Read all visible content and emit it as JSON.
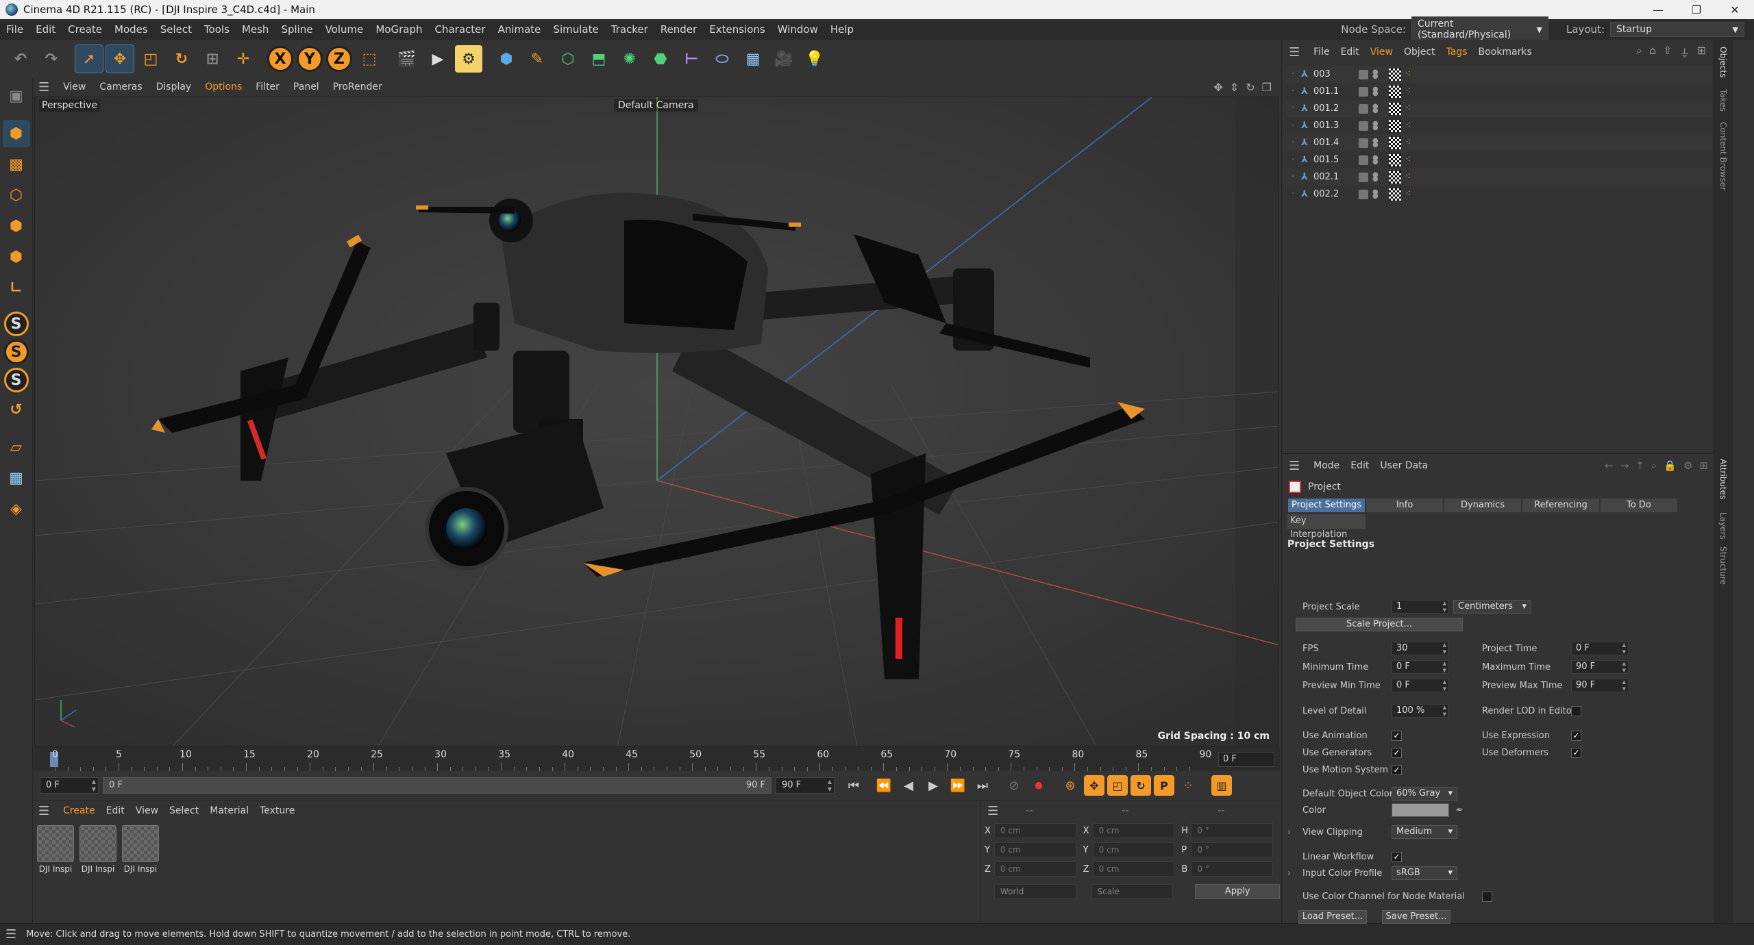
{
  "window": {
    "title": "Cinema 4D R21.115 (RC) - [DJI Inspire 3_C4D.c4d] - Main"
  },
  "menubar": {
    "items": [
      "File",
      "Edit",
      "Create",
      "Modes",
      "Select",
      "Tools",
      "Mesh",
      "Spline",
      "Volume",
      "MoGraph",
      "Character",
      "Animate",
      "Simulate",
      "Tracker",
      "Render",
      "Extensions",
      "Window",
      "Help"
    ],
    "node_space_label": "Node Space:",
    "node_space_value": "Current (Standard/Physical)",
    "layout_label": "Layout:",
    "layout_value": "Startup"
  },
  "viewport": {
    "menu": [
      "View",
      "Cameras",
      "Display",
      "Options",
      "Filter",
      "Panel",
      "ProRender"
    ],
    "label": "Perspective",
    "camera": "Default Camera",
    "grid_spacing": "Grid Spacing : 10 cm"
  },
  "timeline": {
    "ticks": [
      "0",
      "5",
      "10",
      "15",
      "20",
      "25",
      "30",
      "35",
      "40",
      "45",
      "50",
      "55",
      "60",
      "65",
      "70",
      "75",
      "80",
      "85",
      "90"
    ],
    "current_frame": "0 F",
    "start": "0 F",
    "range_start": "0 F",
    "range_end": "90 F",
    "end": "90 F"
  },
  "materials": {
    "menu": [
      "Create",
      "Edit",
      "View",
      "Select",
      "Material",
      "Texture"
    ],
    "items": [
      "DJI Inspi",
      "DJI Inspi",
      "DJI Inspi"
    ]
  },
  "coords": {
    "head_dash": "--",
    "rows": [
      {
        "a1": "X",
        "v1": "0 cm",
        "a2": "X",
        "v2": "0 cm",
        "a3": "H",
        "v3": "0 °"
      },
      {
        "a1": "Y",
        "v1": "0 cm",
        "a2": "Y",
        "v2": "0 cm",
        "a3": "P",
        "v3": "0 °"
      },
      {
        "a1": "Z",
        "v1": "0 cm",
        "a2": "Z",
        "v2": "0 cm",
        "a3": "B",
        "v3": "0 °"
      }
    ],
    "space": "World",
    "mode": "Scale",
    "apply": "Apply"
  },
  "status": "Move: Click and drag to move elements. Hold down SHIFT to quantize movement / add to the selection in point mode, CTRL to remove.",
  "objects": {
    "menu": [
      "File",
      "Edit",
      "View",
      "Object",
      "Tags",
      "Bookmarks"
    ],
    "items": [
      "003",
      "001.1",
      "001.2",
      "001.3",
      "001.4",
      "001.5",
      "002.1",
      "002.2"
    ]
  },
  "side_tabs": {
    "top": [
      "Objects",
      "Takes",
      "Content Browser"
    ],
    "bottom": [
      "Attributes",
      "Layers",
      "Structure"
    ]
  },
  "attributes": {
    "menu": [
      "Mode",
      "Edit",
      "User Data"
    ],
    "object": "Project",
    "tabs": [
      "Project Settings",
      "Info",
      "Dynamics",
      "Referencing",
      "To Do"
    ],
    "tab2": "Key Interpolation",
    "section": "Project Settings",
    "project_scale_label": "Project Scale",
    "project_scale": "1",
    "project_scale_unit": "Centimeters",
    "scale_project_btn": "Scale Project...",
    "fps_label": "FPS",
    "fps": "30",
    "project_time_label": "Project Time",
    "project_time": "0 F",
    "min_time_label": "Minimum Time",
    "min_time": "0 F",
    "max_time_label": "Maximum Time",
    "max_time": "90 F",
    "prev_min_label": "Preview Min Time",
    "prev_min": "0 F",
    "prev_max_label": "Preview Max Time",
    "prev_max": "90 F",
    "lod_label": "Level of Detail",
    "lod": "100 %",
    "render_lod_label": "Render LOD in Editor",
    "use_animation": "Use Animation",
    "use_expression": "Use Expression",
    "use_generators": "Use Generators",
    "use_deformers": "Use Deformers",
    "use_motion": "Use Motion System",
    "default_color_label": "Default Object Color",
    "default_color": "60% Gray",
    "color_label": "Color",
    "view_clipping_label": "View Clipping",
    "view_clipping": "Medium",
    "linear_workflow": "Linear Workflow",
    "input_profile_label": "Input Color Profile",
    "input_profile": "sRGB",
    "use_color_channel": "Use Color Channel for Node Material",
    "load_preset": "Load Preset...",
    "save_preset": "Save Preset..."
  },
  "colors": {
    "accent": "#f39a2a",
    "selection": "#4b6f9a",
    "background": "#333333"
  }
}
